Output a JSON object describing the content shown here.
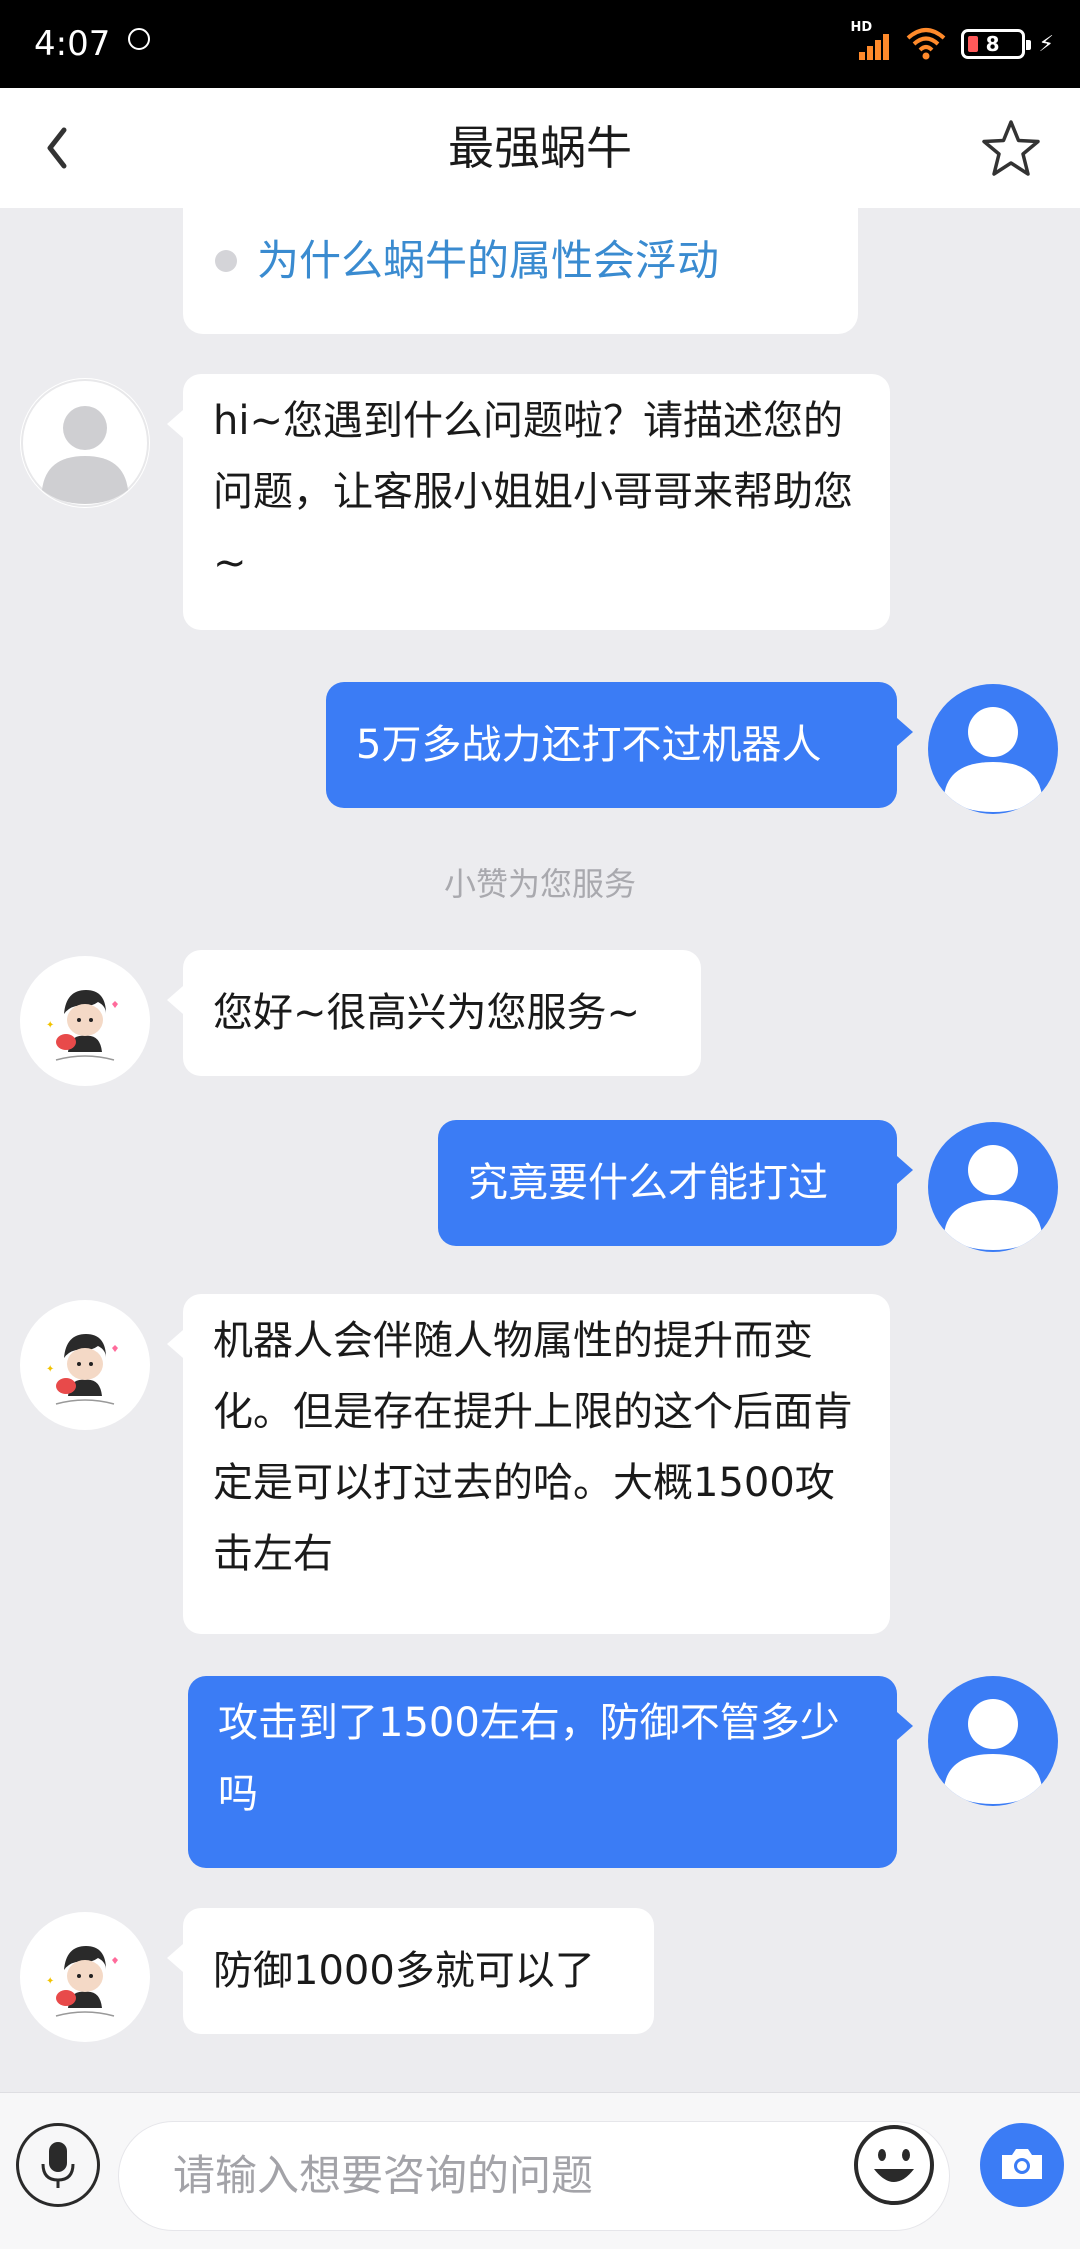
{
  "status_bar": {
    "time": "4:07",
    "network_label": "HD",
    "battery_level": "8"
  },
  "header": {
    "title": "最强蜗牛"
  },
  "suggestion": {
    "text": "为什么蜗牛的属性会浮动"
  },
  "messages": [
    {
      "side": "in",
      "avatar": "default-avatar",
      "text": "hi~您遇到什么问题啦？请描述您的问题，让客服小姐姐小哥哥来帮助您~"
    },
    {
      "side": "out",
      "avatar": "user-avatar",
      "text": "5万多战力还打不过机器人"
    },
    {
      "side": "system",
      "text": "小赞为您服务"
    },
    {
      "side": "in",
      "avatar": "agent-avatar",
      "text": "您好~很高兴为您服务~"
    },
    {
      "side": "out",
      "avatar": "user-avatar",
      "text": "究竟要什么才能打过"
    },
    {
      "side": "in",
      "avatar": "agent-avatar",
      "text": "机器人会伴随人物属性的提升而变化。但是存在提升上限的这个后面肯定是可以打过去的哈。大概1500攻击左右"
    },
    {
      "side": "out",
      "avatar": "user-avatar",
      "text": "攻击到了1500左右，防御不管多少吗"
    },
    {
      "side": "in",
      "avatar": "agent-avatar",
      "text": "防御1000多就可以了"
    }
  ],
  "input": {
    "placeholder": "请输入想要咨询的问题"
  },
  "colors": {
    "accent": "#3b7cf5",
    "link": "#3a8bd0",
    "background": "#ececef"
  },
  "icons": [
    "back-icon",
    "star-icon",
    "microphone-icon",
    "emoji-icon",
    "camera-icon"
  ]
}
